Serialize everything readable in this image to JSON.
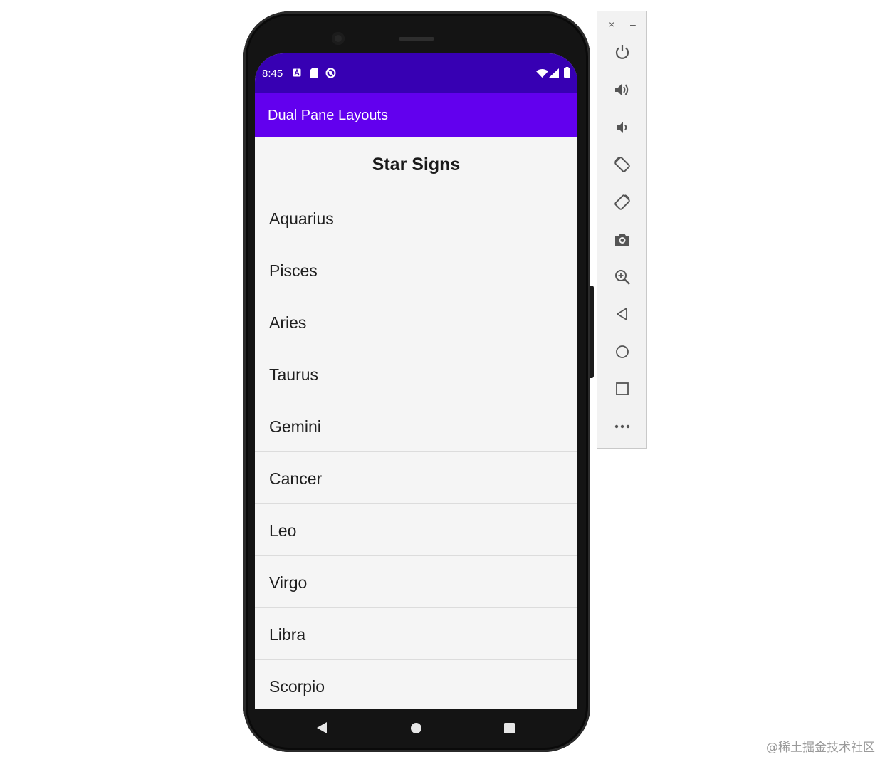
{
  "status_bar": {
    "time": "8:45",
    "left_icons": [
      "a-notification-icon",
      "sd-card-icon",
      "do-not-disturb-icon"
    ],
    "right_icons": [
      "wifi-icon",
      "cellular-signal-icon",
      "battery-icon"
    ]
  },
  "app_bar": {
    "title": "Dual Pane Layouts"
  },
  "list": {
    "header": "Star Signs",
    "items": [
      "Aquarius",
      "Pisces",
      "Aries",
      "Taurus",
      "Gemini",
      "Cancer",
      "Leo",
      "Virgo",
      "Libra",
      "Scorpio"
    ]
  },
  "nav_bar": {
    "buttons": [
      "back-icon",
      "home-icon",
      "recents-icon"
    ]
  },
  "emulator_toolbar": {
    "window_controls": {
      "close": "×",
      "minimize": "–"
    },
    "buttons": [
      "power-icon",
      "volume-up-icon",
      "volume-down-icon",
      "rotate-left-icon",
      "rotate-right-icon",
      "camera-icon",
      "zoom-icon",
      "back-icon",
      "home-icon",
      "overview-icon",
      "more-icon"
    ]
  },
  "colors": {
    "status_bar": "#3700b3",
    "app_bar": "#6200ee",
    "screen_background": "#f5f5f5",
    "divider": "#dcdcdc"
  },
  "watermark": "@稀土掘金技术社区"
}
